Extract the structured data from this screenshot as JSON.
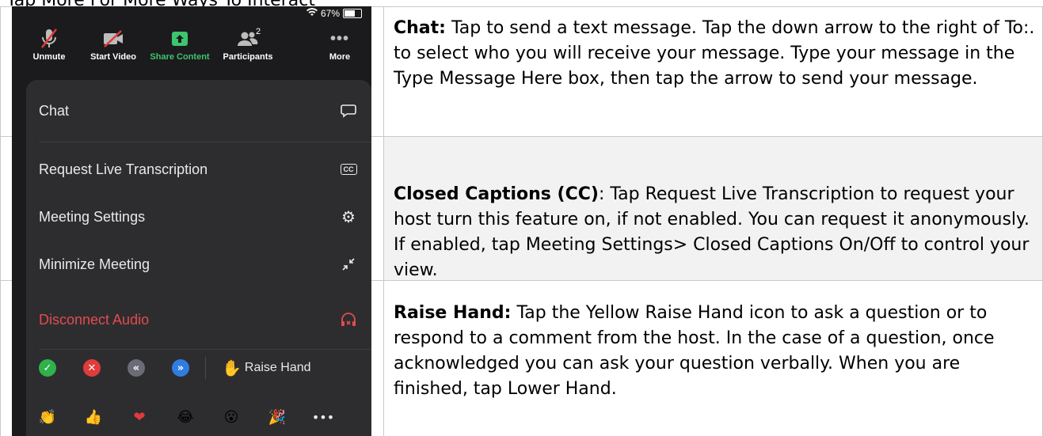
{
  "header_partial": "Tap More For More Ways To Interact",
  "phone": {
    "status": {
      "wifi_icon": "wifi-icon",
      "battery_percent": "67%",
      "battery_level": 0.67
    },
    "toolbar": {
      "unmute": "Unmute",
      "start_video": "Start Video",
      "share_content": "Share Content",
      "participants": "Participants",
      "participants_count": "2",
      "more": "More"
    },
    "menu": {
      "chat": "Chat",
      "request_transcription": "Request Live Transcription",
      "cc_icon_text": "CC",
      "meeting_settings": "Meeting Settings",
      "minimize_meeting": "Minimize Meeting",
      "disconnect_audio": "Disconnect Audio",
      "raise_hand": "Raise Hand"
    },
    "colors": {
      "share_green": "#3ec46d",
      "disconnect_red": "#e24c4c",
      "yes": "#2fb24a",
      "no": "#e23b3b",
      "slower": "#6c6c78",
      "faster": "#2f7de1"
    }
  },
  "rows": [
    {
      "title": "Chat:",
      "text": " Tap to send a text message. Tap the down arrow to the right of To:. to select who you will receive your message. Type your message in the Type Message Here box, then tap the arrow to send your message."
    },
    {
      "title": "Closed Captions (CC)",
      "text": ": Tap Request Live Transcription to request your host turn this feature on, if not enabled. You can request it anonymously.  If enabled, tap Meeting Settings> Closed Captions On/Off to control your view."
    },
    {
      "title": "Raise Hand:",
      "text": "  Tap the Yellow Raise Hand icon to ask a question or to respond to a comment from the host. In the case of a question, once acknowledged you can ask your question verbally. When you are finished, tap Lower Hand."
    }
  ]
}
